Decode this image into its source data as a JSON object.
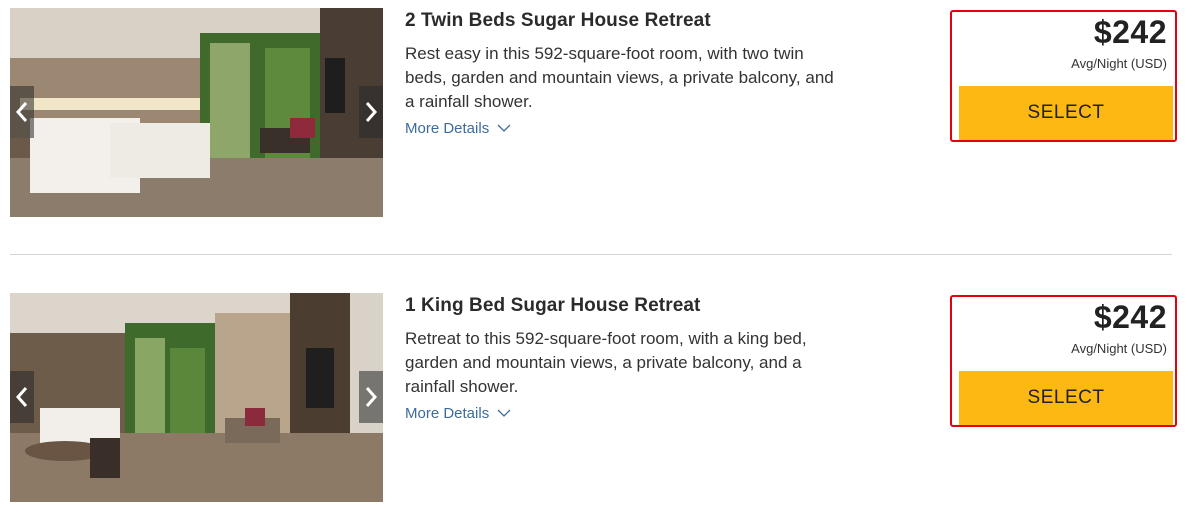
{
  "rooms": [
    {
      "title": "2 Twin Beds Sugar House Retreat",
      "description": "Rest easy in this 592-square-foot room, with two twin beds, garden and mountain views, a private balcony, and a rainfall shower.",
      "more_details": "More Details",
      "price": "$242",
      "price_note": "Avg/Night (USD)",
      "select_label": "SELECT"
    },
    {
      "title": "1 King Bed Sugar House Retreat",
      "description": "Retreat to this 592-square-foot room, with a king bed, garden and mountain views, a private balcony, and a rainfall shower.",
      "more_details": "More Details",
      "price": "$242",
      "price_note": "Avg/Night (USD)",
      "select_label": "SELECT"
    }
  ],
  "icons": {
    "prev": "chevron-left-icon",
    "next": "chevron-right-icon",
    "expand": "chevron-down-icon"
  },
  "colors": {
    "select_button": "#fdb813",
    "highlight_border": "#e3000f",
    "link": "#3d6b9e"
  }
}
